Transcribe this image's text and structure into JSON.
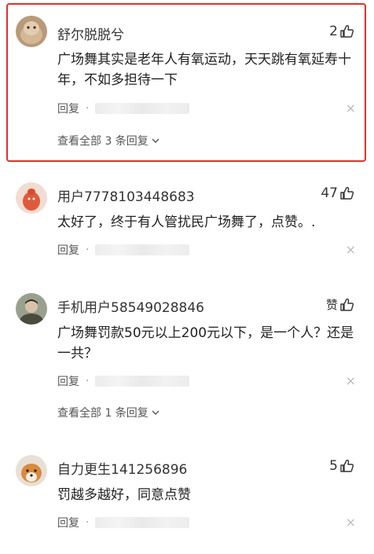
{
  "comments": [
    {
      "name": "舒尔脱脱兮",
      "likes": "2",
      "text": "广场舞其实是老年人有氧运动，天天跳有氧延寿十年，不如多担待一下",
      "reply_label": "回复",
      "dot": "·",
      "close": "×",
      "view_all": "查看全部 3 条回复"
    },
    {
      "name": "用户7778103448683",
      "likes": "47",
      "text": "太好了，终于有人管扰民广场舞了，点赞。.",
      "reply_label": "回复",
      "dot": "·",
      "close": "×"
    },
    {
      "name": "手机用户58549028846",
      "likes": "赞",
      "text": "广场舞罚款50元以上200元以下，是一个人？还是一共？",
      "reply_label": "回复",
      "dot": "·",
      "close": "×",
      "view_all": "查看全部 1 条回复"
    },
    {
      "name": "自力更生141256896",
      "likes": "5",
      "text": "罚越多越好，同意点赞",
      "reply_label": "回复",
      "dot": "·",
      "close": "×"
    }
  ],
  "colors": {
    "highlight": "#e0302a",
    "text": "#222222",
    "muted": "#555555"
  }
}
